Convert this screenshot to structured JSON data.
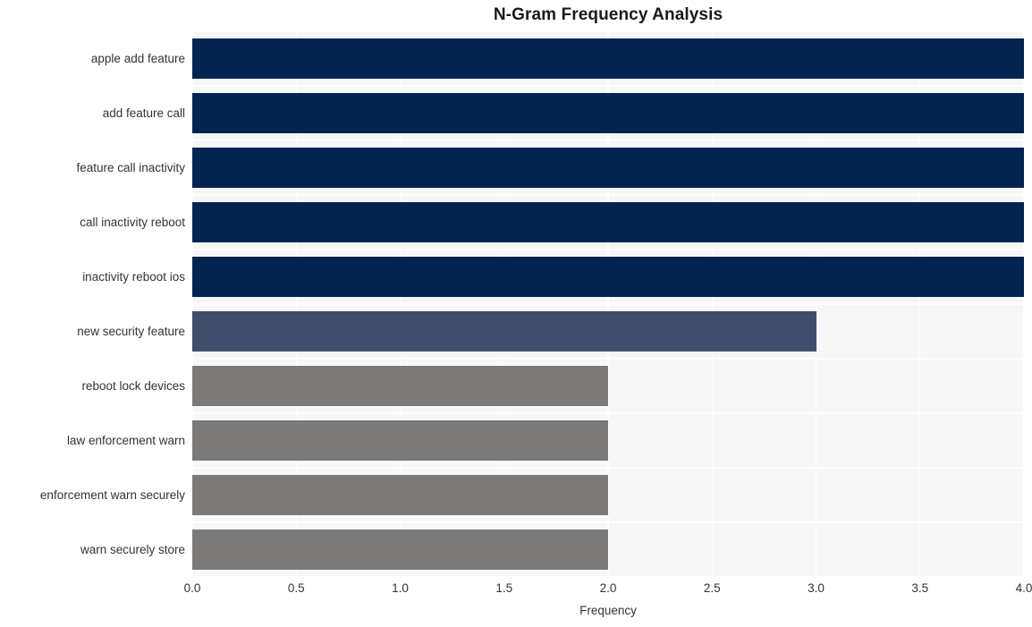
{
  "chart_data": {
    "type": "bar",
    "orientation": "horizontal",
    "title": "N-Gram Frequency Analysis",
    "xlabel": "Frequency",
    "ylabel": "",
    "categories": [
      "apple add feature",
      "add feature call",
      "feature call inactivity",
      "call inactivity reboot",
      "inactivity reboot ios",
      "new security feature",
      "reboot lock devices",
      "law enforcement warn",
      "enforcement warn securely",
      "warn securely store"
    ],
    "values": [
      4,
      4,
      4,
      4,
      4,
      3,
      2,
      2,
      2,
      2
    ],
    "bar_colors": [
      "#032451",
      "#032451",
      "#032451",
      "#032451",
      "#032451",
      "#424d6b",
      "#7b7a78",
      "#7b7a78",
      "#7b7a78",
      "#7b7a78"
    ],
    "xlim": [
      0.0,
      4.0
    ],
    "xticks": [
      0.0,
      0.5,
      1.0,
      1.5,
      2.0,
      2.5,
      3.0,
      3.5,
      4.0
    ],
    "xtick_labels": [
      "0.0",
      "0.5",
      "1.0",
      "1.5",
      "2.0",
      "2.5",
      "3.0",
      "3.5",
      "4.0"
    ],
    "grid": true,
    "grid_color": "#ffffff",
    "plot_background": "#f7f7f7",
    "figure_background": "#ffffff",
    "legend": null
  }
}
